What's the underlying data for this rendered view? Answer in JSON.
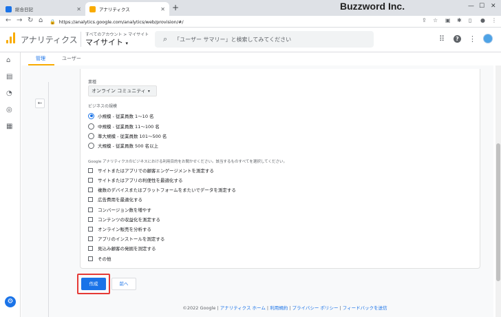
{
  "browser": {
    "tabs": [
      {
        "title": "総合日記",
        "active": false
      },
      {
        "title": "アナリティクス",
        "active": true
      }
    ],
    "url": "https://analytics.google.com/analytics/web/provision/#/",
    "brand_overlay": "Buzzword Inc."
  },
  "header": {
    "app_title": "アナリティクス",
    "account_path": "すべてのアカウント > マイサイト",
    "account_name": "マイサイト",
    "search_placeholder": "「ユーザー サマリー」と検索してみてください"
  },
  "subtabs": [
    {
      "label": "管理",
      "active": true
    },
    {
      "label": "ユーザー",
      "active": false
    }
  ],
  "form": {
    "industry_label": "業種",
    "industry_value": "オンライン コミュニティ",
    "size_label": "ビジネスの規模",
    "sizes": [
      {
        "label": "小規模 - 従業員数 1～10 名",
        "checked": true
      },
      {
        "label": "中規模 - 従業員数 11～100 名",
        "checked": false
      },
      {
        "label": "準大規模 - 従業員数 101～500 名",
        "checked": false
      },
      {
        "label": "大規模 - 従業員数 500 名以上",
        "checked": false
      }
    ],
    "usage_hint": "Google アナリティクスのビジネスにおける利用目的をお聞かせください。該当するものすべてを選択してください。",
    "usages": [
      "サイトまたはアプリでの顧客エンゲージメントを測定する",
      "サイトまたはアプリの利便性を最適化する",
      "複数のデバイスまたはプラットフォームをまたいでデータを測定する",
      "広告費用を最適化する",
      "コンバージョン数を増やす",
      "コンテンツの収益化を測定する",
      "オンライン販売を分析する",
      "アプリのインストールを測定する",
      "見込み顧客の発掘を測定する",
      "その他"
    ],
    "create_button": "作成",
    "back_button": "前へ"
  },
  "footer": {
    "copyright": "©2022 Google",
    "links": [
      "アナリティクス ホーム",
      "利用規約",
      "プライバシー ポリシー"
    ],
    "feedback": "フィードバックを送信"
  },
  "colors": {
    "accent": "#1a73e8",
    "highlight": "#e53935",
    "ga_orange": "#f9ab00"
  }
}
